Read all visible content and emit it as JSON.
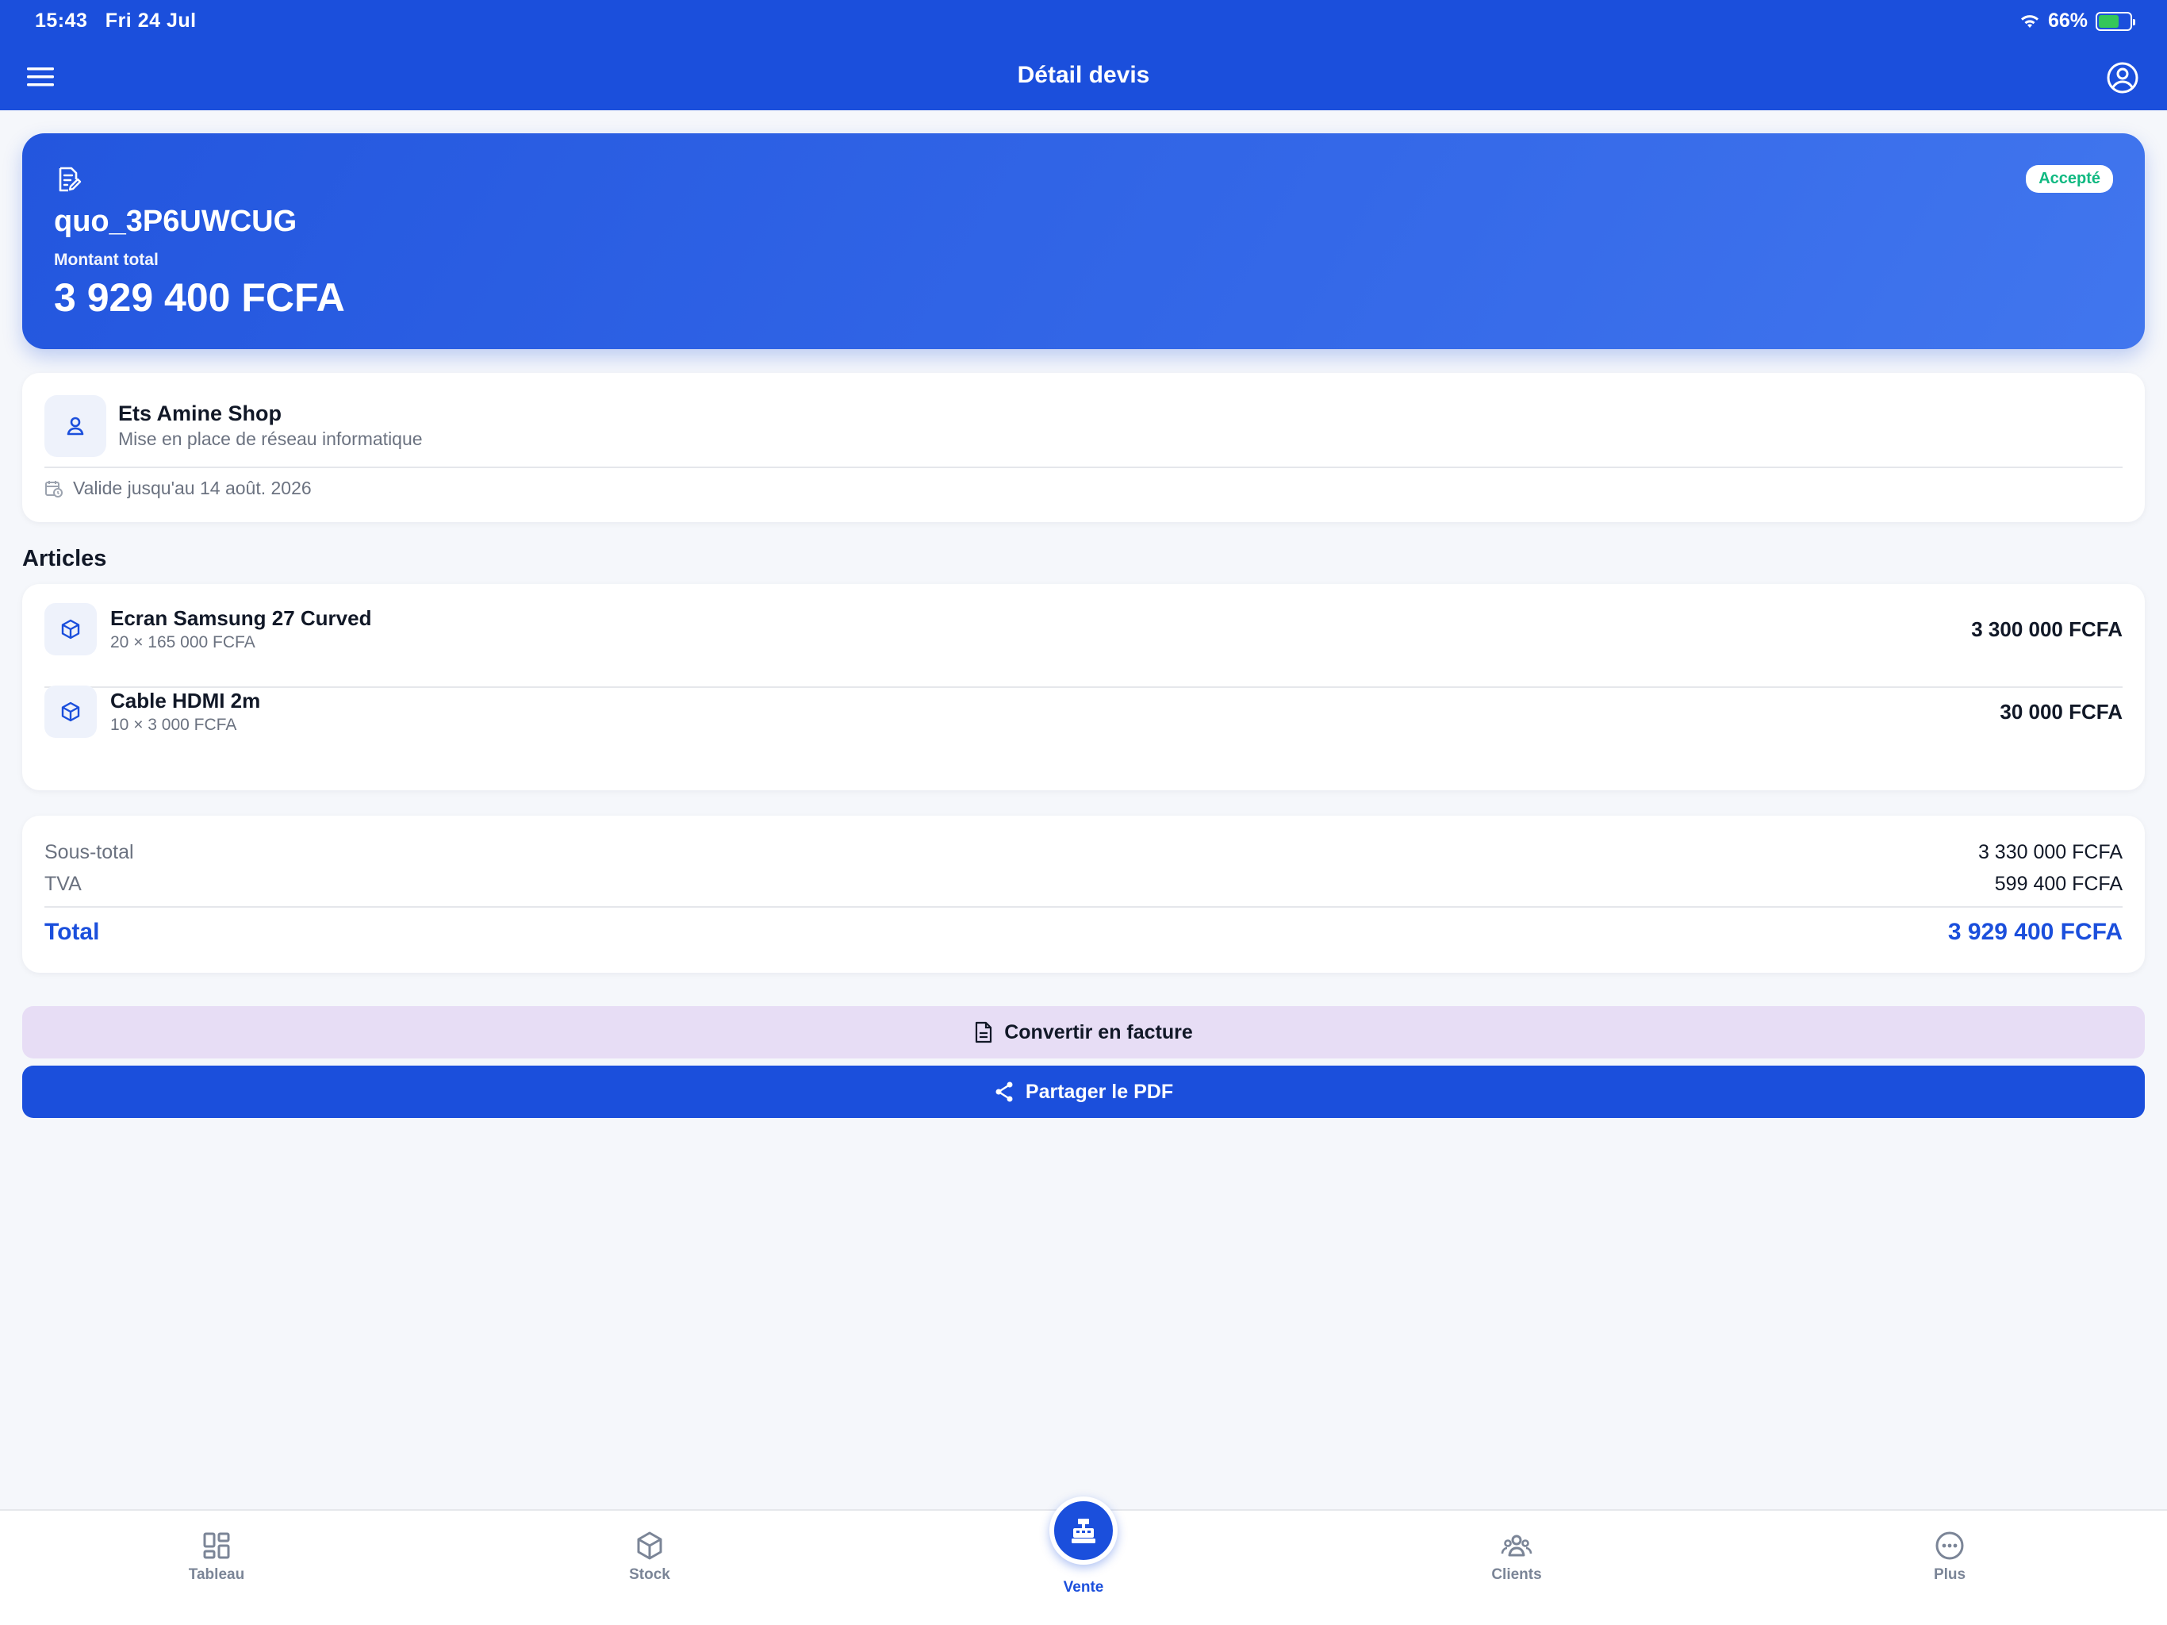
{
  "status": {
    "time": "15:43",
    "date": "Fri 24 Jul",
    "battery": "66%",
    "battery_level": 0.66
  },
  "header": {
    "title": "Détail devis"
  },
  "quote": {
    "id": "quo_3P6UWCUG",
    "amount_label": "Montant total",
    "amount": "3 929 400 FCFA",
    "status": "Accepté",
    "status_color": "#10b981"
  },
  "client": {
    "name": "Ets Amine Shop",
    "description": "Mise en place de réseau informatique",
    "valid_until": "Valide jusqu'au 14 août. 2026"
  },
  "articles": {
    "title": "Articles",
    "items": [
      {
        "name": "Ecran Samsung 27 Curved",
        "detail": "20 × 165 000 FCFA",
        "total": "3 300 000 FCFA"
      },
      {
        "name": "Cable HDMI 2m",
        "detail": "10 × 3 000 FCFA",
        "total": "30 000 FCFA"
      }
    ]
  },
  "totals": {
    "subtotal_label": "Sous-total",
    "subtotal": "3 330 000 FCFA",
    "tax_label": "TVA",
    "tax": "599 400 FCFA",
    "total_label": "Total",
    "total": "3 929 400 FCFA"
  },
  "actions": {
    "convert_label": "Convertir en facture",
    "share_label": "Partager le PDF"
  },
  "nav": {
    "items": [
      {
        "label": "Tableau",
        "icon": "dashboard-icon"
      },
      {
        "label": "Stock",
        "icon": "box-icon"
      },
      {
        "label": "Vente",
        "icon": "cash-register-icon"
      },
      {
        "label": "Clients",
        "icon": "users-icon"
      },
      {
        "label": "Plus",
        "icon": "more-icon"
      }
    ],
    "active": "Vente"
  },
  "colors": {
    "primary": "#1b4fdc",
    "background": "#f5f7fb",
    "convert_button": "#e7ddf5",
    "muted_text": "#6b7280"
  }
}
